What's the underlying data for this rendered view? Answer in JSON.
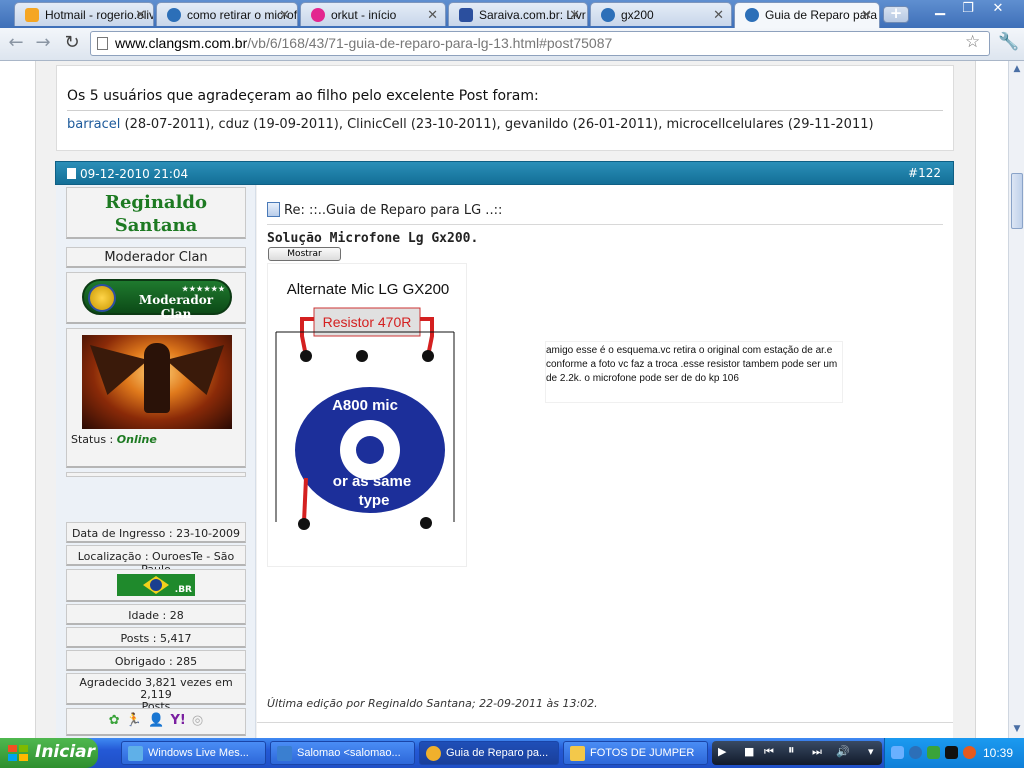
{
  "browser": {
    "tabs": [
      {
        "label": "Hotmail - rogerio.oliv",
        "icon": "hotmail-icon",
        "color": "#f5a623"
      },
      {
        "label": "como retirar o microf",
        "icon": "clangsm-icon",
        "color": "#2c6fb8"
      },
      {
        "label": "orkut - início",
        "icon": "orkut-icon",
        "color": "#e3268f"
      },
      {
        "label": "Saraiva.com.br: Livr",
        "icon": "saraiva-icon",
        "color": "#2b4f9e"
      },
      {
        "label": "gx200",
        "icon": "clangsm-icon",
        "color": "#2c6fb8"
      },
      {
        "label": "Guia de Reparo para",
        "icon": "clangsm-icon",
        "color": "#2c6fb8"
      }
    ],
    "url_host": "www.clangsm.com.br",
    "url_path": "/vb/6/168/43/71-guia-de-reparo-para-lg-13.html#post75087"
  },
  "thanks": {
    "title": "Os 5 usuários que agradeçeram ao filho pelo excelente Post foram:",
    "users": [
      {
        "name": "barracel",
        "date": "(28-07-2011)"
      },
      {
        "name": "cduz",
        "date": "(19-09-2011)"
      },
      {
        "name": "ClinicCell",
        "date": "(23-10-2011)"
      },
      {
        "name": "gevanildo",
        "date": "(26-01-2011)"
      },
      {
        "name": "microcellcelulares",
        "date": "(29-11-2011)"
      }
    ]
  },
  "post": {
    "date": "09-12-2010 21:04",
    "number": "#122",
    "title": "Re: ::..Guia de Reparo para LG ..::",
    "subtitle": "Solução Microfone Lg Gx200.",
    "spoiler_button": "Mostrar",
    "note": "amigo esse é o esquema.vc retira o original com estação de ar.e conforme  a foto vc faz a troca .esse resistor tambem pode ser um de 2.2k. o microfone pode ser de do kp 106",
    "edited": "Última edição por Reginaldo Santana; 22-09-2011 às 13:02."
  },
  "schematic": {
    "title": "Alternate Mic LG GX200",
    "resistor": "Resistor 470R",
    "mic_label": "A800 mic",
    "mic_sub1": "or as same",
    "mic_sub2": "type"
  },
  "user": {
    "name_line1": "Reginaldo",
    "name_line2": "Santana",
    "rank": "Moderador Clan",
    "badge_text": "Moderador Clan",
    "badge_stars": "★★★★★★",
    "status_label": "Status :",
    "status_value": "Online",
    "joined": "Data de Ingresso : 23-10-2009",
    "location": "Localização : OuroesTe - São Paulo",
    "flag_label": ".BR",
    "age": "Idade : 28",
    "posts": "Posts : 5,417",
    "thanked": "Obrigado : 285",
    "thanked_by_line1": "Agradecido 3,821 vezes em 2,119",
    "thanked_by_line2": "Posts"
  },
  "taskbar": {
    "start": "Iniciar",
    "tasks": [
      {
        "label": "Windows Live Mes...",
        "color": "#5fb0e8"
      },
      {
        "label": "Salomao <salomao...",
        "color": "#3a7fd0"
      },
      {
        "label": "Guia de Reparo pa...",
        "color": "#f0b02c"
      },
      {
        "label": "FOTOS DE JUMPER",
        "color": "#f3c84a"
      }
    ],
    "clock": "10:39"
  },
  "colors": {
    "post_header": "#1a7aa3",
    "username": "#1d7a22",
    "link": "#1d5a9b"
  }
}
